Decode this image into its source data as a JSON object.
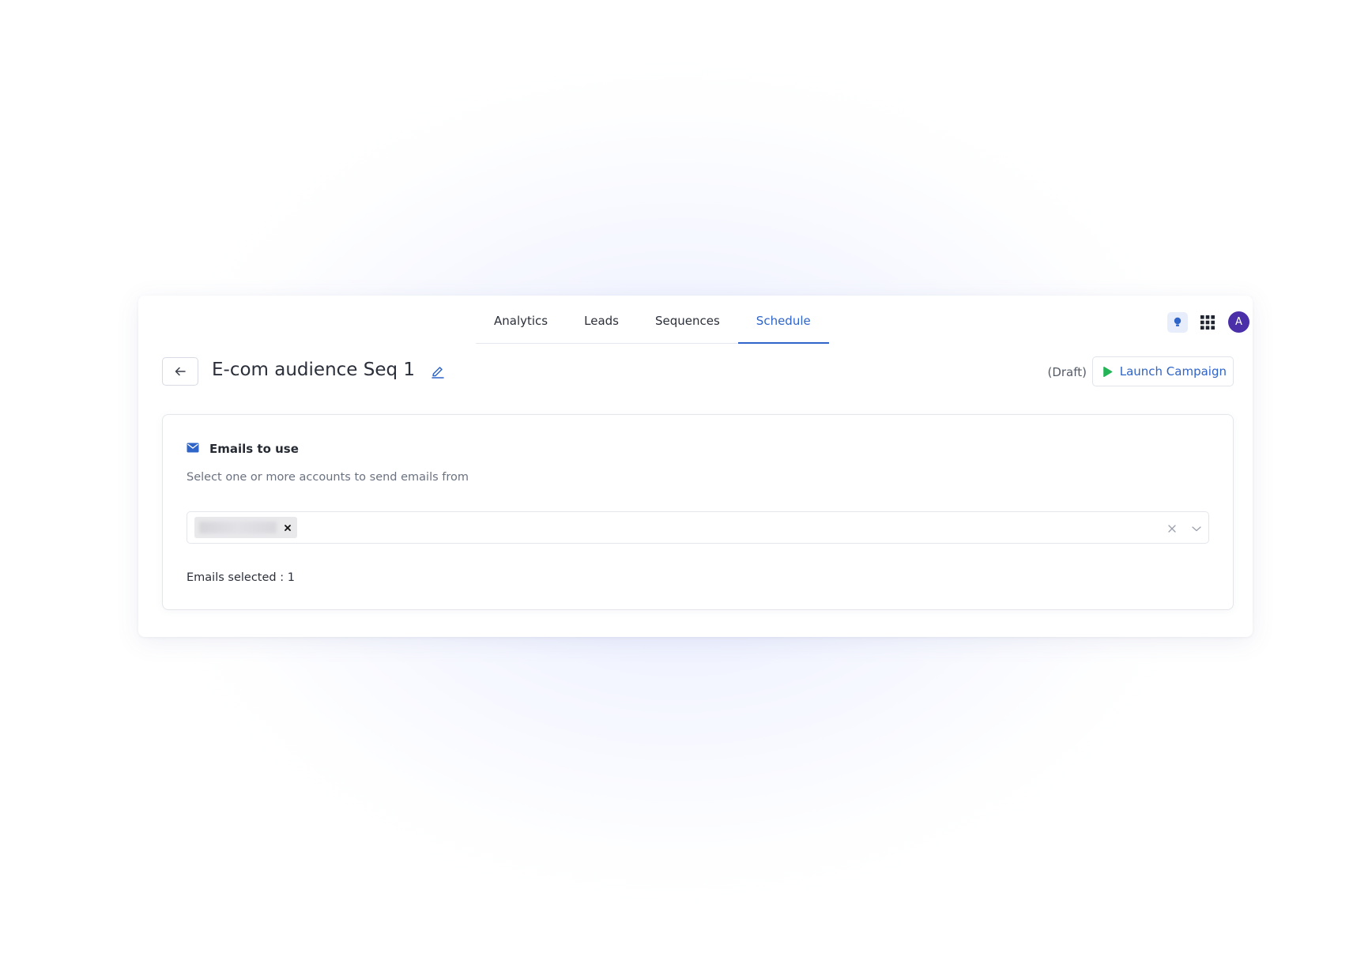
{
  "nav": {
    "tabs": [
      {
        "label": "Analytics"
      },
      {
        "label": "Leads"
      },
      {
        "label": "Sequences"
      },
      {
        "label": "Schedule"
      }
    ],
    "active_tab": "Schedule",
    "avatar_initial": "A"
  },
  "header": {
    "campaign_title": "E-com audience Seq 1",
    "status": "(Draft)",
    "launch_label": "Launch Campaign"
  },
  "emails_card": {
    "title": "Emails to use",
    "subtitle": "Select one or more accounts to send emails from",
    "selected_chip": "",
    "count_label": "Emails selected : 1"
  },
  "icons": {
    "back": "arrow-left-icon",
    "edit": "pencil-icon",
    "launch": "play-icon",
    "bulb": "lightbulb-icon",
    "apps": "grid-icon",
    "mail": "mail-icon",
    "chip_remove": "close-icon",
    "clear": "close-icon",
    "dropdown": "chevron-down-icon"
  },
  "colors": {
    "accent": "#2f64c8",
    "launch_icon": "#22b455",
    "avatar": "#4a2fa8"
  }
}
